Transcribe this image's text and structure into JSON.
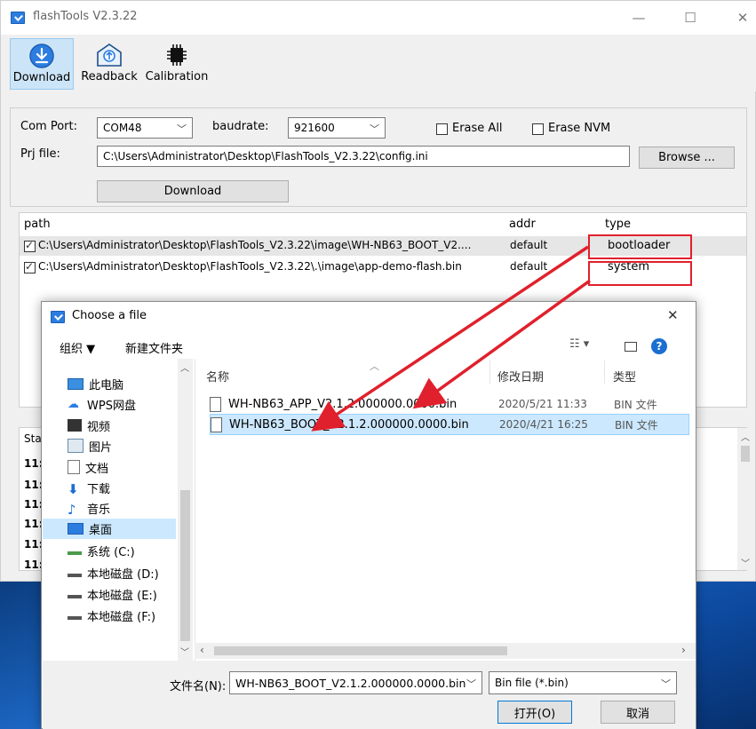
{
  "window": {
    "title": "flashTools V2.3.22",
    "controls": {
      "minimize": "—",
      "maximize": "☐",
      "close": "✕"
    }
  },
  "toolbar": {
    "download": "Download",
    "readback": "Readback",
    "calibration": "Calibration"
  },
  "form": {
    "com_port_label": "Com Port:",
    "com_port_value": "COM48",
    "baudrate_label": "baudrate:",
    "baudrate_value": "921600",
    "erase_all": "Erase All",
    "erase_nvm": "Erase NVM",
    "prj_label": "Prj file:",
    "prj_value": "C:\\Users\\Administrator\\Desktop\\FlashTools_V2.3.22\\config.ini",
    "browse": "Browse ...",
    "download_button": "Download"
  },
  "file_table": {
    "headers": {
      "path": "path",
      "addr": "addr",
      "type": "type"
    },
    "rows": [
      {
        "path": "C:\\Users\\Administrator\\Desktop\\FlashTools_V2.3.22\\image\\WH-NB63_BOOT_V2....",
        "addr": "default",
        "type": "bootloader",
        "checked": true
      },
      {
        "path": "C:\\Users\\Administrator\\Desktop\\FlashTools_V2.3.22\\.\\image\\app-demo-flash.bin",
        "addr": "default",
        "type": "system",
        "checked": true
      }
    ]
  },
  "status_log": {
    "header": "Sta",
    "rows": [
      "11:",
      "11:",
      "11:",
      "11:",
      "11:",
      "11:"
    ]
  },
  "dialog": {
    "title": "Choose a file",
    "close": "✕",
    "organize": "组织 ▼",
    "new_folder": "新建文件夹",
    "nav": [
      {
        "label": "此电脑",
        "icon": "computer-icon"
      },
      {
        "label": "WPS网盘",
        "icon": "cloud-icon"
      },
      {
        "label": "视频",
        "icon": "video-icon"
      },
      {
        "label": "图片",
        "icon": "picture-icon"
      },
      {
        "label": "文档",
        "icon": "document-icon"
      },
      {
        "label": "下载",
        "icon": "download-icon"
      },
      {
        "label": "音乐",
        "icon": "music-icon"
      },
      {
        "label": "桌面",
        "icon": "desktop-icon"
      },
      {
        "label": "系统 (C:)",
        "icon": "drive-icon"
      },
      {
        "label": "本地磁盘 (D:)",
        "icon": "drive-icon"
      },
      {
        "label": "本地磁盘 (E:)",
        "icon": "drive-icon"
      },
      {
        "label": "本地磁盘 (F:)",
        "icon": "drive-icon"
      }
    ],
    "selected_nav": "桌面",
    "columns": {
      "name": "名称",
      "date": "修改日期",
      "type": "类型"
    },
    "files": [
      {
        "name": "WH-NB63_APP_V2.1.2.000000.0000.bin",
        "date": "2020/5/21 11:33",
        "type": "BIN 文件"
      },
      {
        "name": "WH-NB63_BOOT_V2.1.2.000000.0000.bin",
        "date": "2020/4/21 16:25",
        "type": "BIN 文件"
      }
    ],
    "filename_label": "文件名(N):",
    "filename_value": "WH-NB63_BOOT_V2.1.2.000000.0000.bin",
    "filter_value": "Bin file (*.bin)",
    "open": "打开(O)",
    "cancel": "取消"
  },
  "colors": {
    "highlight": "#e0202c",
    "selection": "#cce8ff",
    "accent": "#2d7de0"
  }
}
